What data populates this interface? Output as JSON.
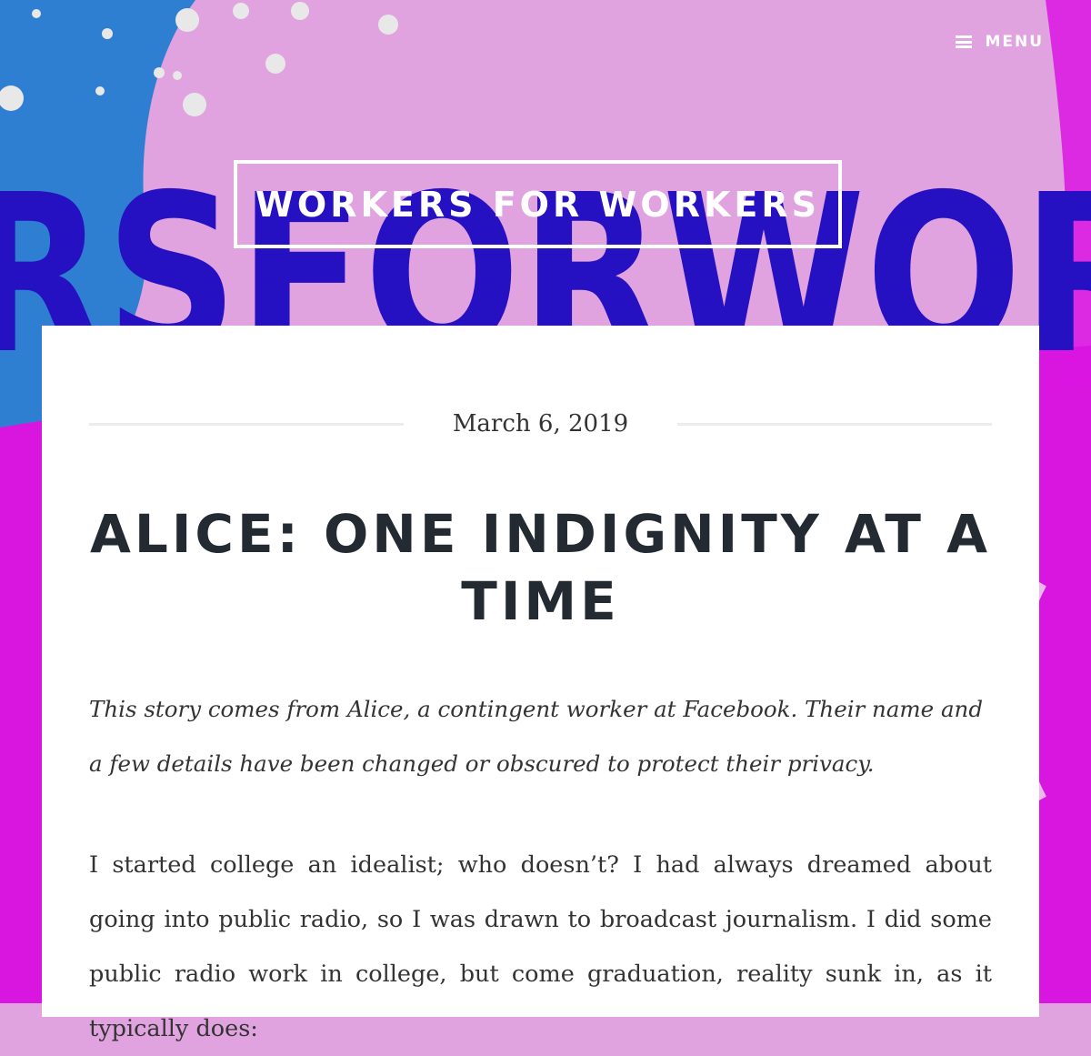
{
  "header": {
    "menu_label": "MENU",
    "menu_icon": "hamburger-icon",
    "site_title": "WORKERS FOR WORKERS",
    "banner_lettering": "RSFORWOR"
  },
  "post": {
    "date": "March 6, 2019",
    "title": "ALICE: ONE INDIGNITY AT A TIME",
    "intro": "This story comes from Alice, a contingent worker at Facebook. Their name and a few details have been changed or obscured to protect their privacy.",
    "body": "I started college an idealist; who doesn’t? I had always dreamed about going into public radio, so I was drawn to broadcast journalism. I did some public radio work in college, but come graduation, reality sunk in, as it typically does:"
  },
  "colors": {
    "pink": "#e0a3e0",
    "magenta": "#d915e0",
    "blue": "#2e7fd1",
    "navy_lettering": "#2510c2",
    "title_text": "#232a31"
  }
}
